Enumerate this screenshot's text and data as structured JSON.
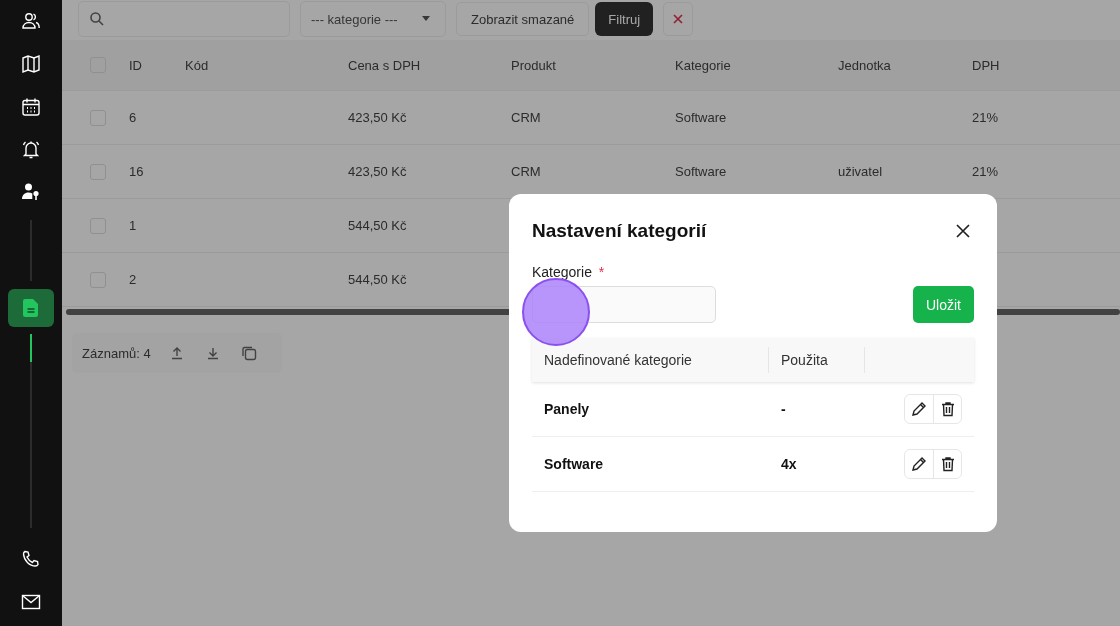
{
  "sidebar": {
    "items": [
      {
        "selected": false
      },
      {
        "selected": false
      },
      {
        "selected": false
      },
      {
        "selected": false
      },
      {
        "selected": false
      },
      {
        "selected": true
      },
      {
        "selected": false
      },
      {
        "selected": false
      }
    ]
  },
  "toolbar": {
    "category_select": "--- kategorie ---",
    "show_deleted_button": "Zobrazit smazané",
    "filter_button": "Filtruj"
  },
  "table": {
    "all_checked": false,
    "columns": [
      "ID",
      "Kód",
      "Cena s DPH",
      "Produkt",
      "Kategorie",
      "Jednotka",
      "DPH"
    ],
    "rows": [
      {
        "checked": false,
        "cells": [
          "6",
          "",
          "423,50 Kč",
          "CRM",
          "Software",
          "",
          "21%"
        ]
      },
      {
        "checked": false,
        "cells": [
          "16",
          "",
          "423,50 Kč",
          "CRM",
          "Software",
          "uživatel",
          "21%"
        ]
      },
      {
        "checked": false,
        "cells": [
          "1",
          "",
          "544,50 Kč",
          "",
          "",
          "",
          ""
        ]
      },
      {
        "checked": false,
        "cells": [
          "2",
          "",
          "544,50 Kč",
          "",
          "",
          "",
          ""
        ]
      }
    ]
  },
  "footer": {
    "record_count": "Záznamů: 4"
  },
  "dialog": {
    "title": "Nastavení kategorií",
    "field_label": "Kategorie",
    "required_mark": "*",
    "save_button": "Uložit",
    "columns": [
      "Nadefinované kategorie",
      "Použita"
    ],
    "rows": [
      {
        "name": "Panely",
        "usage": "-"
      },
      {
        "name": "Software",
        "usage": "4x"
      }
    ]
  }
}
